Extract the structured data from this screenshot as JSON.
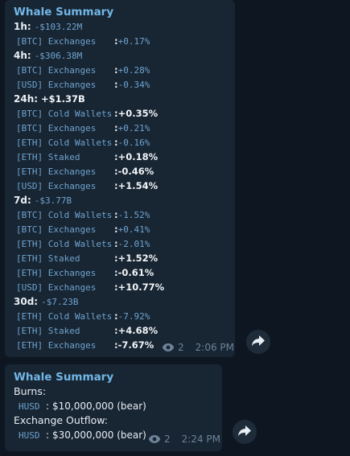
{
  "messages": [
    {
      "title": "Whale Summary",
      "lines": [
        {
          "type": "period",
          "label": "1h:",
          "value": "-$103.22M",
          "style": "mono"
        },
        {
          "type": "row",
          "label": "[BTC] Exchanges",
          "colon": ":",
          "value": "+0.17%",
          "style": "mono"
        },
        {
          "type": "period",
          "label": "4h:",
          "value": "-$306.38M",
          "style": "mono"
        },
        {
          "type": "row",
          "label": "[BTC] Exchanges",
          "colon": ":",
          "value": "+0.28%",
          "style": "mono"
        },
        {
          "type": "row",
          "label": "[USD] Exchanges",
          "colon": ":",
          "value": "-0.34%",
          "style": "mono"
        },
        {
          "type": "period",
          "label": "24h:",
          "value": "+$1.37B",
          "style": "bold"
        },
        {
          "type": "row",
          "label": "[BTC] Cold Wallets",
          "colon": ":",
          "value": "+0.35%",
          "style": "bold"
        },
        {
          "type": "row",
          "label": "[BTC] Exchanges",
          "colon": ":",
          "value": "+0.21%",
          "style": "mono"
        },
        {
          "type": "row",
          "label": "[ETH] Cold Wallets",
          "colon": ":",
          "value": "-0.16%",
          "style": "mono"
        },
        {
          "type": "row",
          "label": "[ETH] Staked",
          "colon": ":",
          "value": "+0.18%",
          "style": "bold"
        },
        {
          "type": "row",
          "label": "[ETH] Exchanges",
          "colon": ":",
          "value": "-0.46%",
          "style": "bold"
        },
        {
          "type": "row",
          "label": "[USD] Exchanges",
          "colon": ":",
          "value": "+1.54%",
          "style": "bold"
        },
        {
          "type": "period",
          "label": "7d:",
          "value": "-$3.77B",
          "style": "mono"
        },
        {
          "type": "row",
          "label": "[BTC] Cold Wallets",
          "colon": ":",
          "value": "-1.52%",
          "style": "mono"
        },
        {
          "type": "row",
          "label": "[BTC] Exchanges",
          "colon": ":",
          "value": "+0.41%",
          "style": "mono"
        },
        {
          "type": "row",
          "label": "[ETH] Cold Wallets",
          "colon": ":",
          "value": "-2.01%",
          "style": "mono"
        },
        {
          "type": "row",
          "label": "[ETH] Staked",
          "colon": ":",
          "value": "+1.52%",
          "style": "bold"
        },
        {
          "type": "row",
          "label": "[ETH] Exchanges",
          "colon": ":",
          "value": "-0.61%",
          "style": "bold"
        },
        {
          "type": "row",
          "label": "[USD] Exchanges",
          "colon": ":",
          "value": "+10.77%",
          "style": "bold"
        },
        {
          "type": "period",
          "label": "30d:",
          "value": "-$7.23B",
          "style": "mono"
        },
        {
          "type": "row",
          "label": "[ETH] Cold Wallets",
          "colon": ":",
          "value": "-7.92%",
          "style": "mono"
        },
        {
          "type": "row",
          "label": "[ETH] Staked",
          "colon": ":",
          "value": "+4.68%",
          "style": "bold"
        },
        {
          "type": "row",
          "label": "[ETH] Exchanges",
          "colon": ":",
          "value": "-7.67%",
          "style": "bold"
        }
      ],
      "views": "2",
      "time": "2:06 PM",
      "view_icon": "eye-icon",
      "share_icon": "share-arrow-icon"
    },
    {
      "title": "Whale Summary",
      "burns_header": "Burns:",
      "burns_label": "HUSD",
      "burns_colon": ":",
      "burns_value": "$10,000,000 (bear)",
      "outflow_header": "Exchange Outflow:",
      "outflow_label": "HUSD",
      "outflow_colon": ":",
      "outflow_value": "$30,000,000 (bear)",
      "views": "2",
      "time": "2:24 PM",
      "view_icon": "eye-icon",
      "share_icon": "share-arrow-icon"
    }
  ],
  "colors": {
    "background": "#0e1621",
    "bubble": "#182533",
    "title": "#71b7e6",
    "mono_text": "#6fa4cf",
    "meta": "#6d8397"
  }
}
